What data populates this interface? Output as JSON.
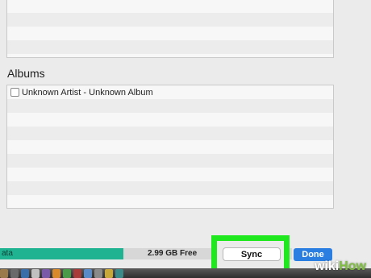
{
  "albums": {
    "title": "Albums",
    "items": [
      {
        "label": "Unknown Artist - Unknown Album",
        "checked": false
      }
    ]
  },
  "capacity": {
    "data_label": "ata",
    "free_label": "2.99 GB Free",
    "data_color": "#1fb392"
  },
  "buttons": {
    "sync_label": "Sync",
    "done_label": "Done"
  },
  "highlight_color": "#20e81f",
  "watermark": {
    "part1": "wiki",
    "part2": "How"
  }
}
